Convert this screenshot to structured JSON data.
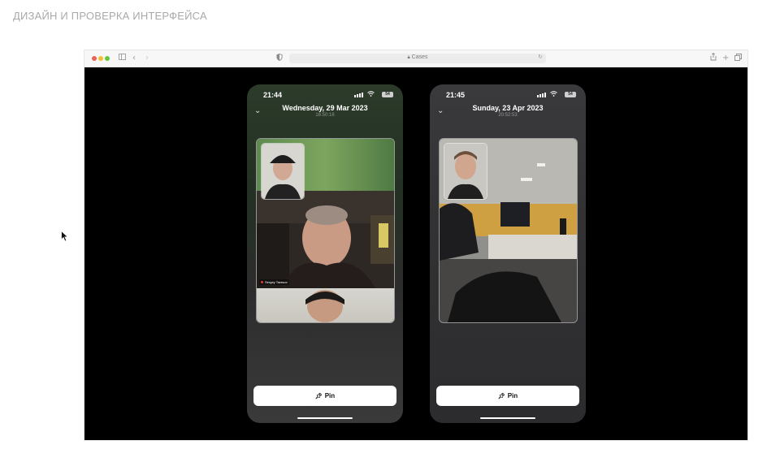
{
  "page": {
    "heading": "ДИЗАЙН И ПРОВЕРКА ИНТЕРФЕЙСА"
  },
  "browser": {
    "url": "Cases",
    "traffic_lights": [
      "#ef5f57",
      "#f5bd2f",
      "#5fc83f"
    ],
    "icons": [
      "sidebar-icon",
      "back-icon",
      "forward-icon",
      "shield-icon",
      "lock-icon",
      "reload-icon",
      "share-icon",
      "new-tab-icon",
      "tabs-overview-icon"
    ]
  },
  "phones": [
    {
      "time": "21:44",
      "battery": "54",
      "date": "Wednesday, 29 Mar 2023",
      "date_sub": "16:50:16",
      "participant_name": "Sergey Tarasov",
      "pin_label": "Pin"
    },
    {
      "time": "21:45",
      "battery": "54",
      "date": "Sunday, 23 Apr 2023",
      "date_sub": "20:52:53",
      "pin_label": "Pin"
    }
  ]
}
